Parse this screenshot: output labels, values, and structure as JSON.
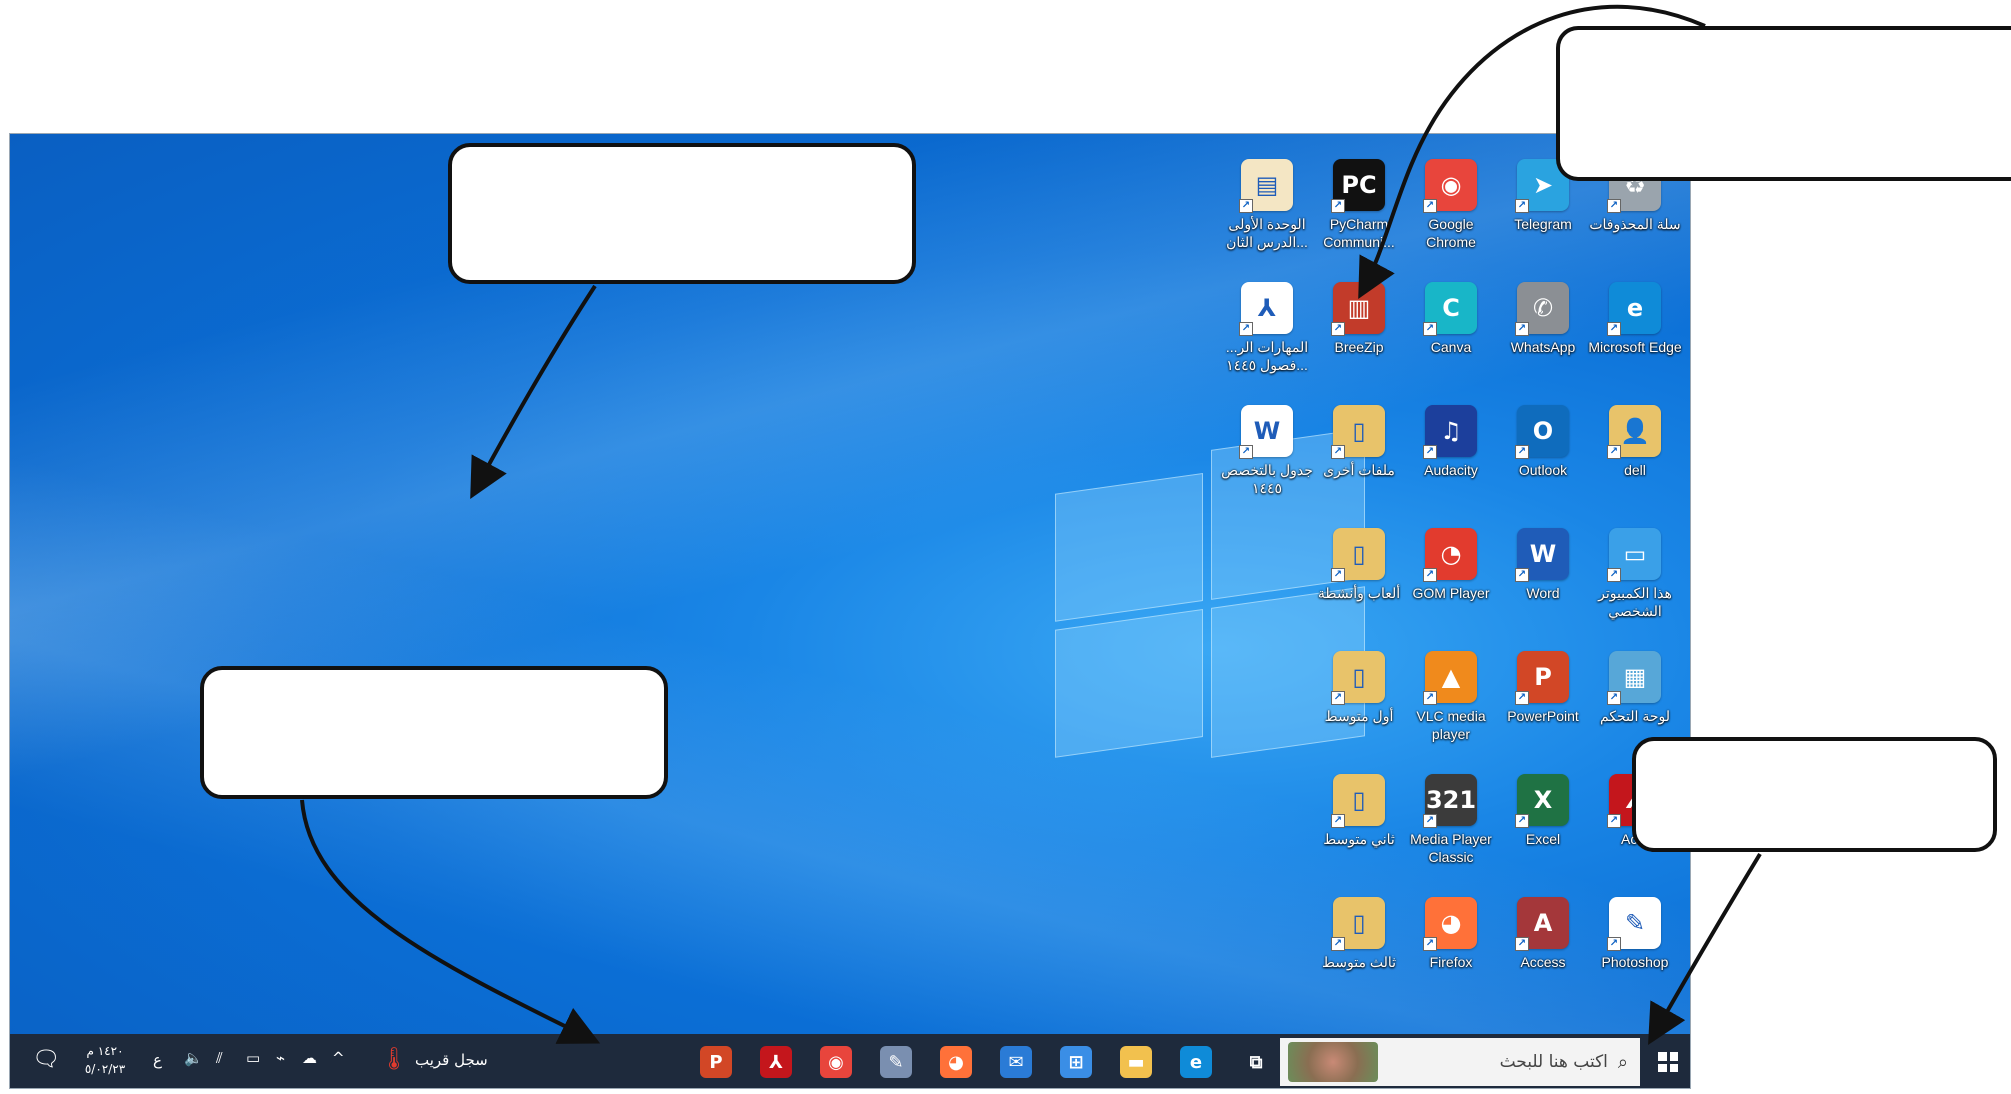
{
  "desktop": {
    "icons": [
      {
        "label": "سلة المحذوفات",
        "icon": "recycle-bin-icon",
        "color": "#9aa4ad",
        "glyph": "♻"
      },
      {
        "label": "Telegram",
        "icon": "telegram-icon",
        "color": "#2aa3e0",
        "glyph": "➤"
      },
      {
        "label": "Google Chrome",
        "icon": "chrome-icon",
        "color": "#e8453c",
        "glyph": "◉"
      },
      {
        "label": "PyCharm Communi...",
        "icon": "pycharm-icon",
        "color": "#111111",
        "glyph": "PC"
      },
      {
        "label": "الوحدة الأولى الدرس الثان...",
        "icon": "document-thumbnail-icon",
        "color": "#f4e6c4",
        "glyph": "▤"
      },
      {
        "label": "Microsoft Edge",
        "icon": "edge-icon",
        "color": "#0f8bd8",
        "glyph": "e"
      },
      {
        "label": "WhatsApp",
        "icon": "whatsapp-icon",
        "color": "#8b8f94",
        "glyph": "✆"
      },
      {
        "label": "Canva",
        "icon": "canva-icon",
        "color": "#18b6c8",
        "glyph": "C"
      },
      {
        "label": "BreeZip",
        "icon": "breezip-icon",
        "color": "#c23b2a",
        "glyph": "▥"
      },
      {
        "label": "...المهارات الر ...فصول ١٤٤٥",
        "icon": "pdf-file-icon",
        "color": "#ffffff",
        "glyph": "⅄"
      },
      {
        "label": "dell",
        "icon": "user-folder-icon",
        "color": "#e8c36a",
        "glyph": "👤"
      },
      {
        "label": "Outlook",
        "icon": "outlook-icon",
        "color": "#0f6cbd",
        "glyph": "O"
      },
      {
        "label": "Audacity",
        "icon": "audacity-icon",
        "color": "#1c3f9c",
        "glyph": "♫"
      },
      {
        "label": "ملفات أخرى",
        "icon": "folder-icon",
        "color": "#e8c36a",
        "glyph": "▯"
      },
      {
        "label": "جدول بالتخصص ١٤٤٥",
        "icon": "word-file-icon",
        "color": "#ffffff",
        "glyph": "W"
      },
      {
        "label": "هذا الكمبيوتر الشخصي",
        "icon": "this-pc-icon",
        "color": "#3aa0e8",
        "glyph": "▭"
      },
      {
        "label": "Word",
        "icon": "word-icon",
        "color": "#1f5cb8",
        "glyph": "W"
      },
      {
        "label": "GOM Player",
        "icon": "gom-player-icon",
        "color": "#e23b2e",
        "glyph": "◔"
      },
      {
        "label": "ألعاب وأنشطة",
        "icon": "folder-icon",
        "color": "#e8c36a",
        "glyph": "▯"
      },
      {
        "label": "لوحة التحكم",
        "icon": "control-panel-icon",
        "color": "#57a7d8",
        "glyph": "▦"
      },
      {
        "label": "PowerPoint",
        "icon": "powerpoint-icon",
        "color": "#d24726",
        "glyph": "P"
      },
      {
        "label": "VLC media player",
        "icon": "vlc-icon",
        "color": "#f08a1c",
        "glyph": "▲"
      },
      {
        "label": "أول متوسط",
        "icon": "folder-icon",
        "color": "#e8c36a",
        "glyph": "▯"
      },
      {
        "label": "Ac...",
        "icon": "acrobat-icon",
        "color": "#c4161c",
        "glyph": "⅄"
      },
      {
        "label": "Excel",
        "icon": "excel-icon",
        "color": "#1f7244",
        "glyph": "X"
      },
      {
        "label": "Media Player Classic",
        "icon": "media-player-classic-icon",
        "color": "#3b3b3b",
        "glyph": "321"
      },
      {
        "label": "ثاني متوسط",
        "icon": "folder-icon",
        "color": "#e8c36a",
        "glyph": "▯"
      },
      {
        "label": "Photoshop",
        "icon": "photoshop-icon",
        "color": "#ffffff",
        "glyph": "✎"
      },
      {
        "label": "Access",
        "icon": "access-icon",
        "color": "#a4373a",
        "glyph": "A"
      },
      {
        "label": "Firefox",
        "icon": "firefox-icon",
        "color": "#ff7139",
        "glyph": "◕"
      },
      {
        "label": "ثالث متوسط",
        "icon": "folder-icon",
        "color": "#e8c36a",
        "glyph": "▯"
      }
    ]
  },
  "taskbar": {
    "search_placeholder": "اكتب هنا للبحث",
    "weather_text": "سجل قريب",
    "clock_time": "١٤٢٠ م",
    "clock_date": "٥/٠٢/٢٣",
    "language": "ع",
    "pinned": [
      {
        "icon": "task-view-icon",
        "color": "#1e2a3c",
        "glyph": "⧉"
      },
      {
        "icon": "edge-icon",
        "color": "#0f8bd8",
        "glyph": "e"
      },
      {
        "icon": "file-explorer-icon",
        "color": "#f2c14e",
        "glyph": "▬"
      },
      {
        "icon": "microsoft-store-icon",
        "color": "#3a8ee6",
        "glyph": "⊞"
      },
      {
        "icon": "mail-icon",
        "color": "#2a7bd6",
        "glyph": "✉"
      },
      {
        "icon": "firefox-icon",
        "color": "#ff7139",
        "glyph": "◕"
      },
      {
        "icon": "paint-icon",
        "color": "#7a8fb0",
        "glyph": "✎"
      },
      {
        "icon": "chrome-icon",
        "color": "#e8453c",
        "glyph": "◉"
      },
      {
        "icon": "acrobat-icon",
        "color": "#c4161c",
        "glyph": "⅄"
      },
      {
        "icon": "powerpoint-icon",
        "color": "#d24726",
        "glyph": "P"
      }
    ]
  },
  "callouts": [
    {
      "id": "callout-top-left",
      "text": ""
    },
    {
      "id": "callout-top-right",
      "text": ""
    },
    {
      "id": "callout-middle-left",
      "text": ""
    },
    {
      "id": "callout-bottom-right",
      "text": ""
    }
  ]
}
